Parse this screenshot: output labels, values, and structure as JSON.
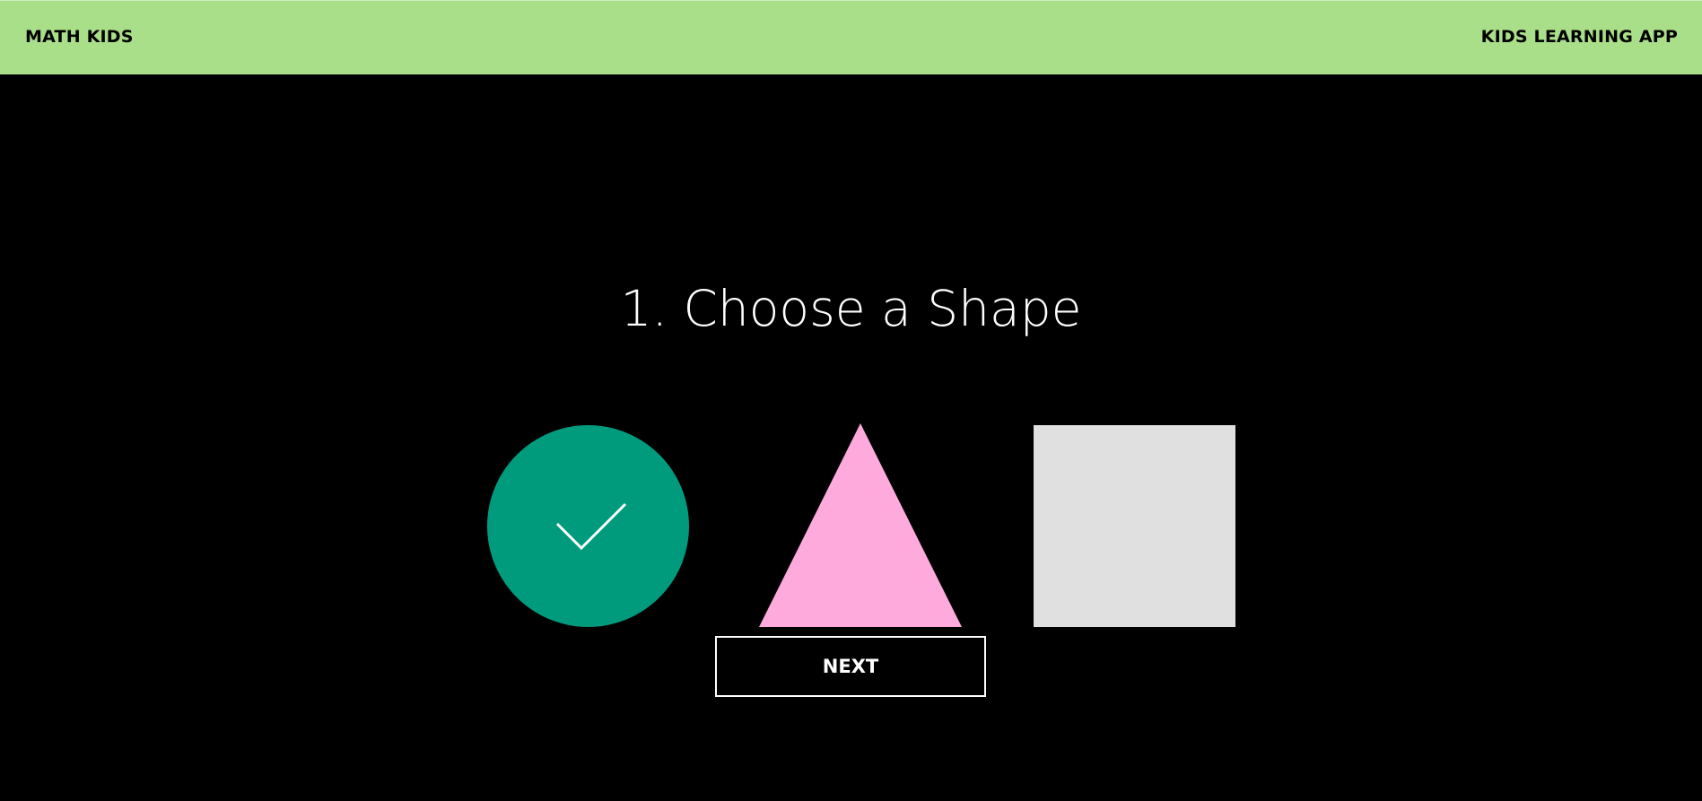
{
  "header": {
    "brand": "MATH KIDS",
    "app_name": "KIDS LEARNING APP"
  },
  "main": {
    "title": "1. Choose a Shape",
    "shapes": [
      {
        "name": "circle",
        "color": "#009a7d",
        "selected": true
      },
      {
        "name": "triangle",
        "color": "#ffaadd",
        "selected": false
      },
      {
        "name": "square",
        "color": "#e0e0e0",
        "selected": false
      }
    ],
    "next_label": "NEXT"
  },
  "icons": {
    "selected": "checkmark-icon"
  },
  "colors": {
    "header_bg": "#a9df89",
    "page_bg": "#000000",
    "text_light": "#ffffff"
  }
}
